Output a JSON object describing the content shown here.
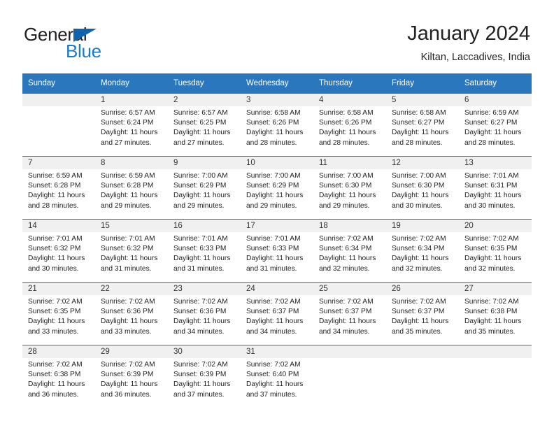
{
  "brand": {
    "name_part1": "General",
    "name_part2": "Blue",
    "flag_icon": "triangle-flag-icon",
    "colors": {
      "blue": "#1a7bc4",
      "flag_blue": "#1263ad",
      "dark": "#231f20"
    }
  },
  "header": {
    "title": "January 2024",
    "subtitle": "Kiltan, Laccadives, India"
  },
  "theme": {
    "header_bg": "#2b77bd",
    "daynum_bg": "#f0f0f0",
    "rule": "#2b77bd",
    "text": "#222222"
  },
  "weekdays": [
    "Sunday",
    "Monday",
    "Tuesday",
    "Wednesday",
    "Thursday",
    "Friday",
    "Saturday"
  ],
  "weeks": [
    [
      {
        "day": "",
        "sunrise": "",
        "sunset": "",
        "daylight_line1": "",
        "daylight_line2": "",
        "empty": true
      },
      {
        "day": "1",
        "sunrise": "Sunrise: 6:57 AM",
        "sunset": "Sunset: 6:24 PM",
        "daylight_line1": "Daylight: 11 hours",
        "daylight_line2": "and 27 minutes.",
        "empty": false
      },
      {
        "day": "2",
        "sunrise": "Sunrise: 6:57 AM",
        "sunset": "Sunset: 6:25 PM",
        "daylight_line1": "Daylight: 11 hours",
        "daylight_line2": "and 27 minutes.",
        "empty": false
      },
      {
        "day": "3",
        "sunrise": "Sunrise: 6:58 AM",
        "sunset": "Sunset: 6:26 PM",
        "daylight_line1": "Daylight: 11 hours",
        "daylight_line2": "and 28 minutes.",
        "empty": false
      },
      {
        "day": "4",
        "sunrise": "Sunrise: 6:58 AM",
        "sunset": "Sunset: 6:26 PM",
        "daylight_line1": "Daylight: 11 hours",
        "daylight_line2": "and 28 minutes.",
        "empty": false
      },
      {
        "day": "5",
        "sunrise": "Sunrise: 6:58 AM",
        "sunset": "Sunset: 6:27 PM",
        "daylight_line1": "Daylight: 11 hours",
        "daylight_line2": "and 28 minutes.",
        "empty": false
      },
      {
        "day": "6",
        "sunrise": "Sunrise: 6:59 AM",
        "sunset": "Sunset: 6:27 PM",
        "daylight_line1": "Daylight: 11 hours",
        "daylight_line2": "and 28 minutes.",
        "empty": false
      }
    ],
    [
      {
        "day": "7",
        "sunrise": "Sunrise: 6:59 AM",
        "sunset": "Sunset: 6:28 PM",
        "daylight_line1": "Daylight: 11 hours",
        "daylight_line2": "and 28 minutes.",
        "empty": false
      },
      {
        "day": "8",
        "sunrise": "Sunrise: 6:59 AM",
        "sunset": "Sunset: 6:28 PM",
        "daylight_line1": "Daylight: 11 hours",
        "daylight_line2": "and 29 minutes.",
        "empty": false
      },
      {
        "day": "9",
        "sunrise": "Sunrise: 7:00 AM",
        "sunset": "Sunset: 6:29 PM",
        "daylight_line1": "Daylight: 11 hours",
        "daylight_line2": "and 29 minutes.",
        "empty": false
      },
      {
        "day": "10",
        "sunrise": "Sunrise: 7:00 AM",
        "sunset": "Sunset: 6:29 PM",
        "daylight_line1": "Daylight: 11 hours",
        "daylight_line2": "and 29 minutes.",
        "empty": false
      },
      {
        "day": "11",
        "sunrise": "Sunrise: 7:00 AM",
        "sunset": "Sunset: 6:30 PM",
        "daylight_line1": "Daylight: 11 hours",
        "daylight_line2": "and 29 minutes.",
        "empty": false
      },
      {
        "day": "12",
        "sunrise": "Sunrise: 7:00 AM",
        "sunset": "Sunset: 6:30 PM",
        "daylight_line1": "Daylight: 11 hours",
        "daylight_line2": "and 30 minutes.",
        "empty": false
      },
      {
        "day": "13",
        "sunrise": "Sunrise: 7:01 AM",
        "sunset": "Sunset: 6:31 PM",
        "daylight_line1": "Daylight: 11 hours",
        "daylight_line2": "and 30 minutes.",
        "empty": false
      }
    ],
    [
      {
        "day": "14",
        "sunrise": "Sunrise: 7:01 AM",
        "sunset": "Sunset: 6:32 PM",
        "daylight_line1": "Daylight: 11 hours",
        "daylight_line2": "and 30 minutes.",
        "empty": false
      },
      {
        "day": "15",
        "sunrise": "Sunrise: 7:01 AM",
        "sunset": "Sunset: 6:32 PM",
        "daylight_line1": "Daylight: 11 hours",
        "daylight_line2": "and 31 minutes.",
        "empty": false
      },
      {
        "day": "16",
        "sunrise": "Sunrise: 7:01 AM",
        "sunset": "Sunset: 6:33 PM",
        "daylight_line1": "Daylight: 11 hours",
        "daylight_line2": "and 31 minutes.",
        "empty": false
      },
      {
        "day": "17",
        "sunrise": "Sunrise: 7:01 AM",
        "sunset": "Sunset: 6:33 PM",
        "daylight_line1": "Daylight: 11 hours",
        "daylight_line2": "and 31 minutes.",
        "empty": false
      },
      {
        "day": "18",
        "sunrise": "Sunrise: 7:02 AM",
        "sunset": "Sunset: 6:34 PM",
        "daylight_line1": "Daylight: 11 hours",
        "daylight_line2": "and 32 minutes.",
        "empty": false
      },
      {
        "day": "19",
        "sunrise": "Sunrise: 7:02 AM",
        "sunset": "Sunset: 6:34 PM",
        "daylight_line1": "Daylight: 11 hours",
        "daylight_line2": "and 32 minutes.",
        "empty": false
      },
      {
        "day": "20",
        "sunrise": "Sunrise: 7:02 AM",
        "sunset": "Sunset: 6:35 PM",
        "daylight_line1": "Daylight: 11 hours",
        "daylight_line2": "and 32 minutes.",
        "empty": false
      }
    ],
    [
      {
        "day": "21",
        "sunrise": "Sunrise: 7:02 AM",
        "sunset": "Sunset: 6:35 PM",
        "daylight_line1": "Daylight: 11 hours",
        "daylight_line2": "and 33 minutes.",
        "empty": false
      },
      {
        "day": "22",
        "sunrise": "Sunrise: 7:02 AM",
        "sunset": "Sunset: 6:36 PM",
        "daylight_line1": "Daylight: 11 hours",
        "daylight_line2": "and 33 minutes.",
        "empty": false
      },
      {
        "day": "23",
        "sunrise": "Sunrise: 7:02 AM",
        "sunset": "Sunset: 6:36 PM",
        "daylight_line1": "Daylight: 11 hours",
        "daylight_line2": "and 34 minutes.",
        "empty": false
      },
      {
        "day": "24",
        "sunrise": "Sunrise: 7:02 AM",
        "sunset": "Sunset: 6:37 PM",
        "daylight_line1": "Daylight: 11 hours",
        "daylight_line2": "and 34 minutes.",
        "empty": false
      },
      {
        "day": "25",
        "sunrise": "Sunrise: 7:02 AM",
        "sunset": "Sunset: 6:37 PM",
        "daylight_line1": "Daylight: 11 hours",
        "daylight_line2": "and 34 minutes.",
        "empty": false
      },
      {
        "day": "26",
        "sunrise": "Sunrise: 7:02 AM",
        "sunset": "Sunset: 6:37 PM",
        "daylight_line1": "Daylight: 11 hours",
        "daylight_line2": "and 35 minutes.",
        "empty": false
      },
      {
        "day": "27",
        "sunrise": "Sunrise: 7:02 AM",
        "sunset": "Sunset: 6:38 PM",
        "daylight_line1": "Daylight: 11 hours",
        "daylight_line2": "and 35 minutes.",
        "empty": false
      }
    ],
    [
      {
        "day": "28",
        "sunrise": "Sunrise: 7:02 AM",
        "sunset": "Sunset: 6:38 PM",
        "daylight_line1": "Daylight: 11 hours",
        "daylight_line2": "and 36 minutes.",
        "empty": false
      },
      {
        "day": "29",
        "sunrise": "Sunrise: 7:02 AM",
        "sunset": "Sunset: 6:39 PM",
        "daylight_line1": "Daylight: 11 hours",
        "daylight_line2": "and 36 minutes.",
        "empty": false
      },
      {
        "day": "30",
        "sunrise": "Sunrise: 7:02 AM",
        "sunset": "Sunset: 6:39 PM",
        "daylight_line1": "Daylight: 11 hours",
        "daylight_line2": "and 37 minutes.",
        "empty": false
      },
      {
        "day": "31",
        "sunrise": "Sunrise: 7:02 AM",
        "sunset": "Sunset: 6:40 PM",
        "daylight_line1": "Daylight: 11 hours",
        "daylight_line2": "and 37 minutes.",
        "empty": false
      },
      {
        "day": "",
        "sunrise": "",
        "sunset": "",
        "daylight_line1": "",
        "daylight_line2": "",
        "empty": true
      },
      {
        "day": "",
        "sunrise": "",
        "sunset": "",
        "daylight_line1": "",
        "daylight_line2": "",
        "empty": true
      },
      {
        "day": "",
        "sunrise": "",
        "sunset": "",
        "daylight_line1": "",
        "daylight_line2": "",
        "empty": true
      }
    ]
  ]
}
